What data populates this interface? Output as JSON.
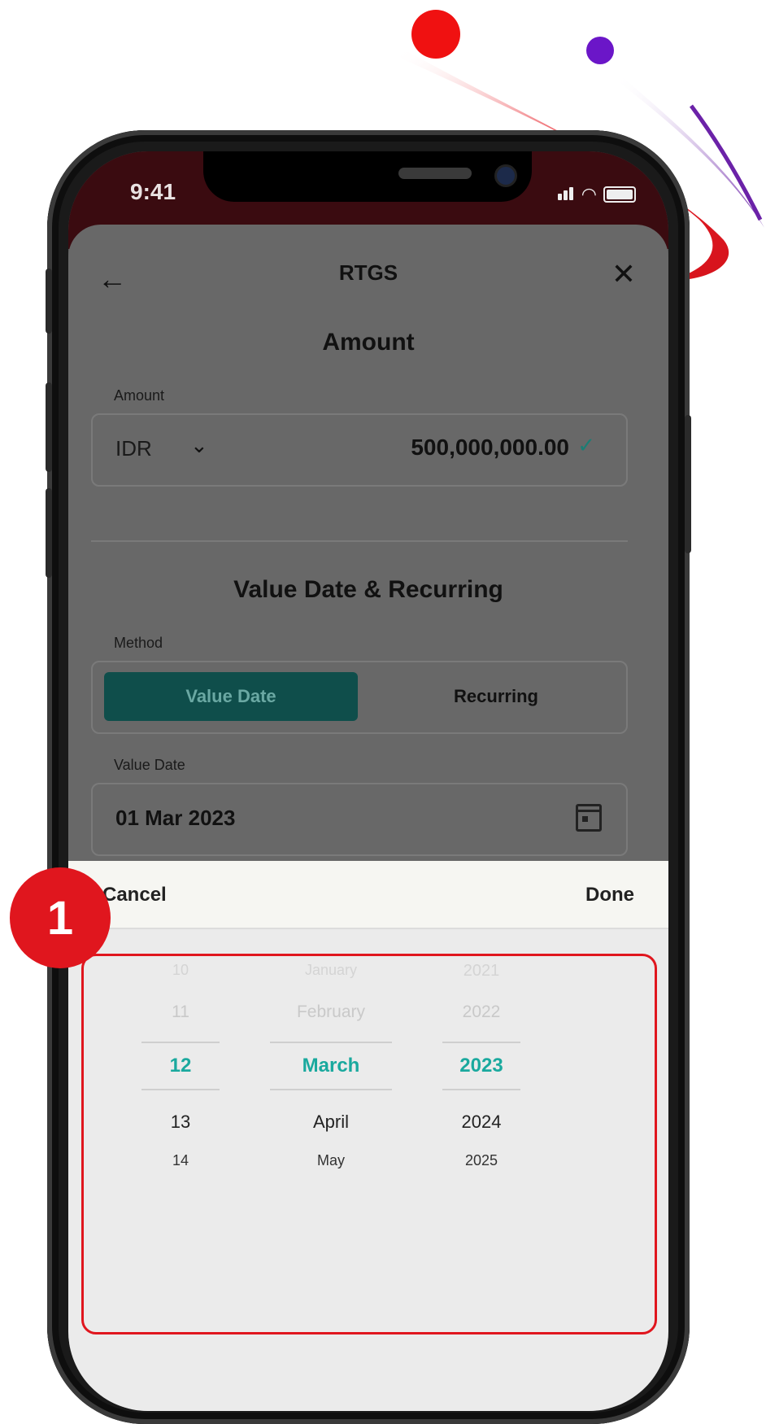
{
  "status_bar": {
    "time": "9:41"
  },
  "header": {
    "back_icon": "arrow-left-icon",
    "title": "RTGS",
    "close_icon": "close-icon"
  },
  "amount_section": {
    "title": "Amount",
    "label": "Amount",
    "currency": "IDR",
    "value": "500,000,000.00",
    "valid_icon": "check-icon"
  },
  "value_date_section": {
    "title": "Value Date & Recurring",
    "method_label": "Method",
    "method_options": [
      "Value Date",
      "Recurring"
    ],
    "selected_method": "Value Date",
    "value_date_label": "Value Date",
    "value_date": "01 Mar 2023"
  },
  "picker": {
    "cancel": "Cancel",
    "done": "Done",
    "days": [
      "10",
      "11",
      "12",
      "13",
      "14"
    ],
    "months": [
      "January",
      "February",
      "March",
      "April",
      "May"
    ],
    "years": [
      "2021",
      "2022",
      "2023",
      "2024",
      "2025"
    ],
    "selected_day": "12",
    "selected_month": "March",
    "selected_year": "2023"
  },
  "annotation": {
    "step_number": "1"
  },
  "colors": {
    "accent_teal": "#1aa99e",
    "highlight_red": "#e0161e",
    "active_segment": "#0f4e4b"
  }
}
